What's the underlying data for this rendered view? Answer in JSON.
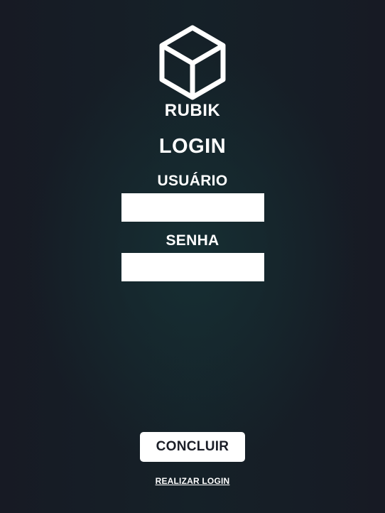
{
  "brand": {
    "logo_icon": "cube-icon",
    "name": "RUBIK"
  },
  "login": {
    "title": "LOGIN",
    "user_label": "USUÁRIO",
    "user_value": "",
    "password_label": "SENHA",
    "password_value": "",
    "submit_label": "CONCLUIR",
    "link_label": "REALIZAR LOGIN"
  },
  "colors": {
    "background": "#171b25",
    "text": "#ffffff",
    "button_bg": "#ffffff",
    "button_text": "#1b1e27"
  }
}
